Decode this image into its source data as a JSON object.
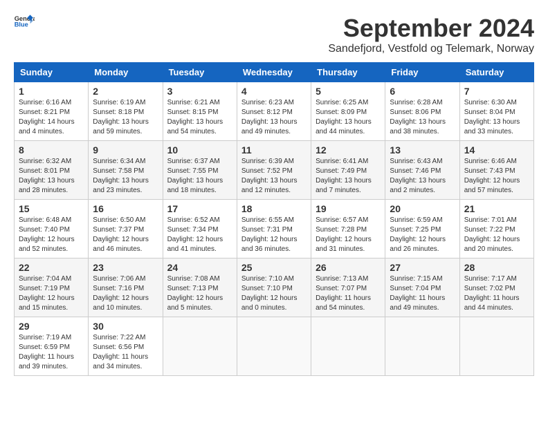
{
  "header": {
    "logo_general": "General",
    "logo_blue": "Blue",
    "title": "September 2024",
    "subtitle": "Sandefjord, Vestfold og Telemark, Norway"
  },
  "weekdays": [
    "Sunday",
    "Monday",
    "Tuesday",
    "Wednesday",
    "Thursday",
    "Friday",
    "Saturday"
  ],
  "weeks": [
    [
      {
        "day": "1",
        "info": "Sunrise: 6:16 AM\nSunset: 8:21 PM\nDaylight: 14 hours\nand 4 minutes."
      },
      {
        "day": "2",
        "info": "Sunrise: 6:19 AM\nSunset: 8:18 PM\nDaylight: 13 hours\nand 59 minutes."
      },
      {
        "day": "3",
        "info": "Sunrise: 6:21 AM\nSunset: 8:15 PM\nDaylight: 13 hours\nand 54 minutes."
      },
      {
        "day": "4",
        "info": "Sunrise: 6:23 AM\nSunset: 8:12 PM\nDaylight: 13 hours\nand 49 minutes."
      },
      {
        "day": "5",
        "info": "Sunrise: 6:25 AM\nSunset: 8:09 PM\nDaylight: 13 hours\nand 44 minutes."
      },
      {
        "day": "6",
        "info": "Sunrise: 6:28 AM\nSunset: 8:06 PM\nDaylight: 13 hours\nand 38 minutes."
      },
      {
        "day": "7",
        "info": "Sunrise: 6:30 AM\nSunset: 8:04 PM\nDaylight: 13 hours\nand 33 minutes."
      }
    ],
    [
      {
        "day": "8",
        "info": "Sunrise: 6:32 AM\nSunset: 8:01 PM\nDaylight: 13 hours\nand 28 minutes."
      },
      {
        "day": "9",
        "info": "Sunrise: 6:34 AM\nSunset: 7:58 PM\nDaylight: 13 hours\nand 23 minutes."
      },
      {
        "day": "10",
        "info": "Sunrise: 6:37 AM\nSunset: 7:55 PM\nDaylight: 13 hours\nand 18 minutes."
      },
      {
        "day": "11",
        "info": "Sunrise: 6:39 AM\nSunset: 7:52 PM\nDaylight: 13 hours\nand 12 minutes."
      },
      {
        "day": "12",
        "info": "Sunrise: 6:41 AM\nSunset: 7:49 PM\nDaylight: 13 hours\nand 7 minutes."
      },
      {
        "day": "13",
        "info": "Sunrise: 6:43 AM\nSunset: 7:46 PM\nDaylight: 13 hours\nand 2 minutes."
      },
      {
        "day": "14",
        "info": "Sunrise: 6:46 AM\nSunset: 7:43 PM\nDaylight: 12 hours\nand 57 minutes."
      }
    ],
    [
      {
        "day": "15",
        "info": "Sunrise: 6:48 AM\nSunset: 7:40 PM\nDaylight: 12 hours\nand 52 minutes."
      },
      {
        "day": "16",
        "info": "Sunrise: 6:50 AM\nSunset: 7:37 PM\nDaylight: 12 hours\nand 46 minutes."
      },
      {
        "day": "17",
        "info": "Sunrise: 6:52 AM\nSunset: 7:34 PM\nDaylight: 12 hours\nand 41 minutes."
      },
      {
        "day": "18",
        "info": "Sunrise: 6:55 AM\nSunset: 7:31 PM\nDaylight: 12 hours\nand 36 minutes."
      },
      {
        "day": "19",
        "info": "Sunrise: 6:57 AM\nSunset: 7:28 PM\nDaylight: 12 hours\nand 31 minutes."
      },
      {
        "day": "20",
        "info": "Sunrise: 6:59 AM\nSunset: 7:25 PM\nDaylight: 12 hours\nand 26 minutes."
      },
      {
        "day": "21",
        "info": "Sunrise: 7:01 AM\nSunset: 7:22 PM\nDaylight: 12 hours\nand 20 minutes."
      }
    ],
    [
      {
        "day": "22",
        "info": "Sunrise: 7:04 AM\nSunset: 7:19 PM\nDaylight: 12 hours\nand 15 minutes."
      },
      {
        "day": "23",
        "info": "Sunrise: 7:06 AM\nSunset: 7:16 PM\nDaylight: 12 hours\nand 10 minutes."
      },
      {
        "day": "24",
        "info": "Sunrise: 7:08 AM\nSunset: 7:13 PM\nDaylight: 12 hours\nand 5 minutes."
      },
      {
        "day": "25",
        "info": "Sunrise: 7:10 AM\nSunset: 7:10 PM\nDaylight: 12 hours\nand 0 minutes."
      },
      {
        "day": "26",
        "info": "Sunrise: 7:13 AM\nSunset: 7:07 PM\nDaylight: 11 hours\nand 54 minutes."
      },
      {
        "day": "27",
        "info": "Sunrise: 7:15 AM\nSunset: 7:04 PM\nDaylight: 11 hours\nand 49 minutes."
      },
      {
        "day": "28",
        "info": "Sunrise: 7:17 AM\nSunset: 7:02 PM\nDaylight: 11 hours\nand 44 minutes."
      }
    ],
    [
      {
        "day": "29",
        "info": "Sunrise: 7:19 AM\nSunset: 6:59 PM\nDaylight: 11 hours\nand 39 minutes."
      },
      {
        "day": "30",
        "info": "Sunrise: 7:22 AM\nSunset: 6:56 PM\nDaylight: 11 hours\nand 34 minutes."
      },
      {
        "day": "",
        "info": ""
      },
      {
        "day": "",
        "info": ""
      },
      {
        "day": "",
        "info": ""
      },
      {
        "day": "",
        "info": ""
      },
      {
        "day": "",
        "info": ""
      }
    ]
  ]
}
